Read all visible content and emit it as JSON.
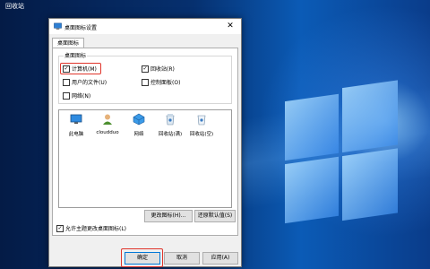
{
  "desktop": {
    "recycle_bin_label": "回收站"
  },
  "dialog": {
    "title": "桌面图标设置",
    "tab_label": "桌面图标",
    "group_label": "桌面图标",
    "checkboxes": [
      {
        "label": "计算机(M)",
        "checked": true
      },
      {
        "label": "回收站(R)",
        "checked": true
      },
      {
        "label": "用户的文件(U)",
        "checked": false
      },
      {
        "label": "控制面板(O)",
        "checked": false
      },
      {
        "label": "网络(N)",
        "checked": false
      }
    ],
    "icons": [
      {
        "label": "此电脑"
      },
      {
        "label": "cloudduo"
      },
      {
        "label": "网络"
      },
      {
        "label": "回收站(满)"
      },
      {
        "label": "回收站(空)"
      }
    ],
    "change_icon_label": "更改图标(H)...",
    "restore_default_label": "还原默认值(S)",
    "allow_themes_label": "允许主题更改桌面图标(L)",
    "ok_label": "确定",
    "cancel_label": "取消",
    "apply_label": "应用(A)",
    "highlight_color": "#e0352b",
    "checkmark": "✓"
  }
}
